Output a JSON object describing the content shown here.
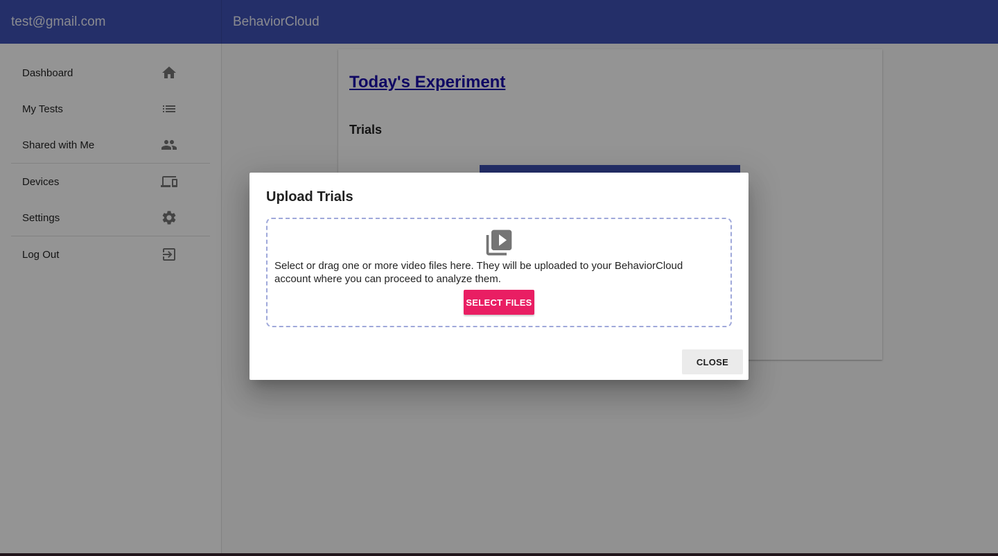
{
  "header": {
    "account_email": "test@gmail.com",
    "app_title": "BehaviorCloud"
  },
  "sidebar": {
    "groups": [
      [
        {
          "label": "Dashboard",
          "icon": "home-icon"
        },
        {
          "label": "My Tests",
          "icon": "list-icon"
        },
        {
          "label": "Shared with Me",
          "icon": "people-icon"
        }
      ],
      [
        {
          "label": "Devices",
          "icon": "devices-icon"
        },
        {
          "label": "Settings",
          "icon": "gear-icon"
        }
      ],
      [
        {
          "label": "Log Out",
          "icon": "logout-icon"
        }
      ]
    ]
  },
  "main": {
    "experiment_title": "Today's Experiment",
    "trials_heading": "Trials"
  },
  "dialog": {
    "title": "Upload Trials",
    "dropzone_icon": "video-library-icon",
    "dropzone_text": "Select or drag one or more video files here. They will be uploaded to your BehaviorCloud account where you can proceed to analyze them.",
    "select_files_label": "SELECT FILES",
    "close_label": "CLOSE"
  },
  "colors": {
    "primary": "#3f51b5",
    "accent": "#e91e63",
    "dropzone_border": "#9fa8da",
    "link": "#1a0dab"
  }
}
